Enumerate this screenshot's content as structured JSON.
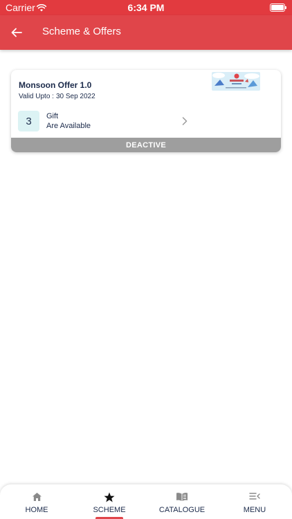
{
  "status_bar": {
    "carrier": "Carrier",
    "time": "6:34 PM"
  },
  "header": {
    "title": "Scheme & Offers"
  },
  "offer_card": {
    "title": "Monsoon Offer 1.0",
    "validity_label": "Valid Upto :",
    "validity_date": "30 Sep 2022",
    "gift_count": "3",
    "gift_label": "Gift",
    "gift_sub_label": "Are Available",
    "status": "DEACTIVE"
  },
  "bottom_nav": {
    "items": [
      {
        "label": "HOME",
        "icon": "home-icon"
      },
      {
        "label": "SCHEME",
        "icon": "star-icon",
        "active": true
      },
      {
        "label": "CATALOGUE",
        "icon": "book-icon"
      },
      {
        "label": "MENU",
        "icon": "menu-icon"
      }
    ]
  },
  "colors": {
    "primary_red": "#e0454a",
    "status_bar_red": "#e23a3f",
    "deactive_gray": "#9e9e9e",
    "gift_badge_bg": "#dcf3f4",
    "text_navy": "#1b2a4a"
  }
}
